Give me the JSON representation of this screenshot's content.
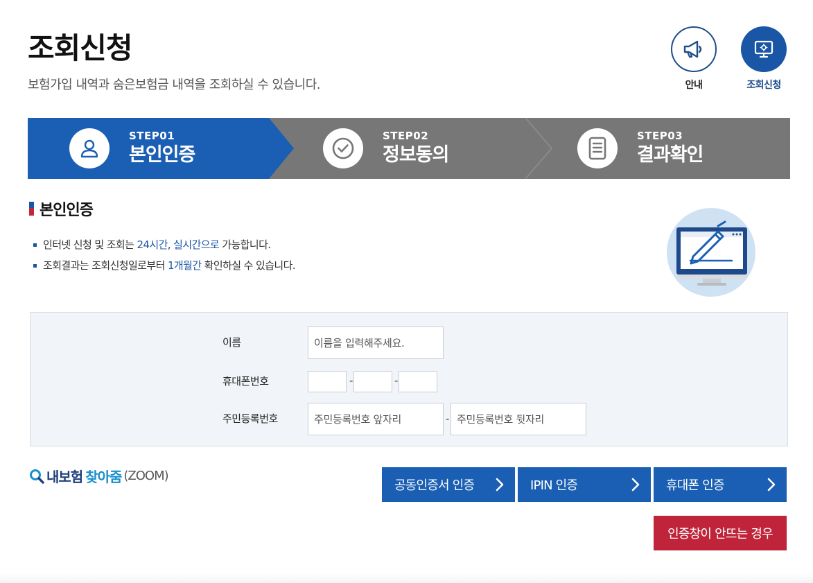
{
  "header": {
    "title": "조회신청",
    "description": "보험가입 내역과 숨은보험금 내역을 조회하실 수 있습니다."
  },
  "quick_links": [
    {
      "label": "안내",
      "icon": "megaphone-icon"
    },
    {
      "label": "조회신청",
      "icon": "monitor-icon",
      "active": true
    }
  ],
  "steps": [
    {
      "number": "STEP01",
      "name": "본인인증",
      "icon": "user-icon",
      "active": true
    },
    {
      "number": "STEP02",
      "name": "정보동의",
      "icon": "check-circle-icon",
      "active": false
    },
    {
      "number": "STEP03",
      "name": "결과확인",
      "icon": "document-icon",
      "active": false
    }
  ],
  "section": {
    "title": "본인인증",
    "notes": [
      {
        "before": "인터넷 신청 및 조회는 ",
        "hl1": "24시간",
        "mid": ", ",
        "hl2": "실시간으로",
        "after": " 가능합니다."
      },
      {
        "before": "조회결과는 조회신청일로부터 ",
        "hl1": "1개월간",
        "after": " 확인하실 수 있습니다."
      }
    ]
  },
  "form": {
    "name_label": "이름",
    "name_placeholder": "이름을 입력해주세요.",
    "phone_label": "휴대폰번호",
    "phone_separator": "-",
    "rrn_label": "주민등록번호",
    "rrn_front_placeholder": "주민등록번호 앞자리",
    "rrn_back_placeholder": "주민등록번호 뒷자리",
    "rrn_separator": "-"
  },
  "zoom_logo": {
    "part1": "내보험",
    "part2": "찾아줌",
    "part3": "(ZOOM)"
  },
  "buttons": {
    "certificate": "공동인증서 인증",
    "ipin": "IPIN 인증",
    "phone": "휴대폰 인증",
    "trouble": "인증창이 안뜨는 경우"
  },
  "colors": {
    "primary": "#1a5fb4",
    "step_inactive": "#777777",
    "danger": "#c0243a",
    "form_bg": "#f1f4f8"
  }
}
